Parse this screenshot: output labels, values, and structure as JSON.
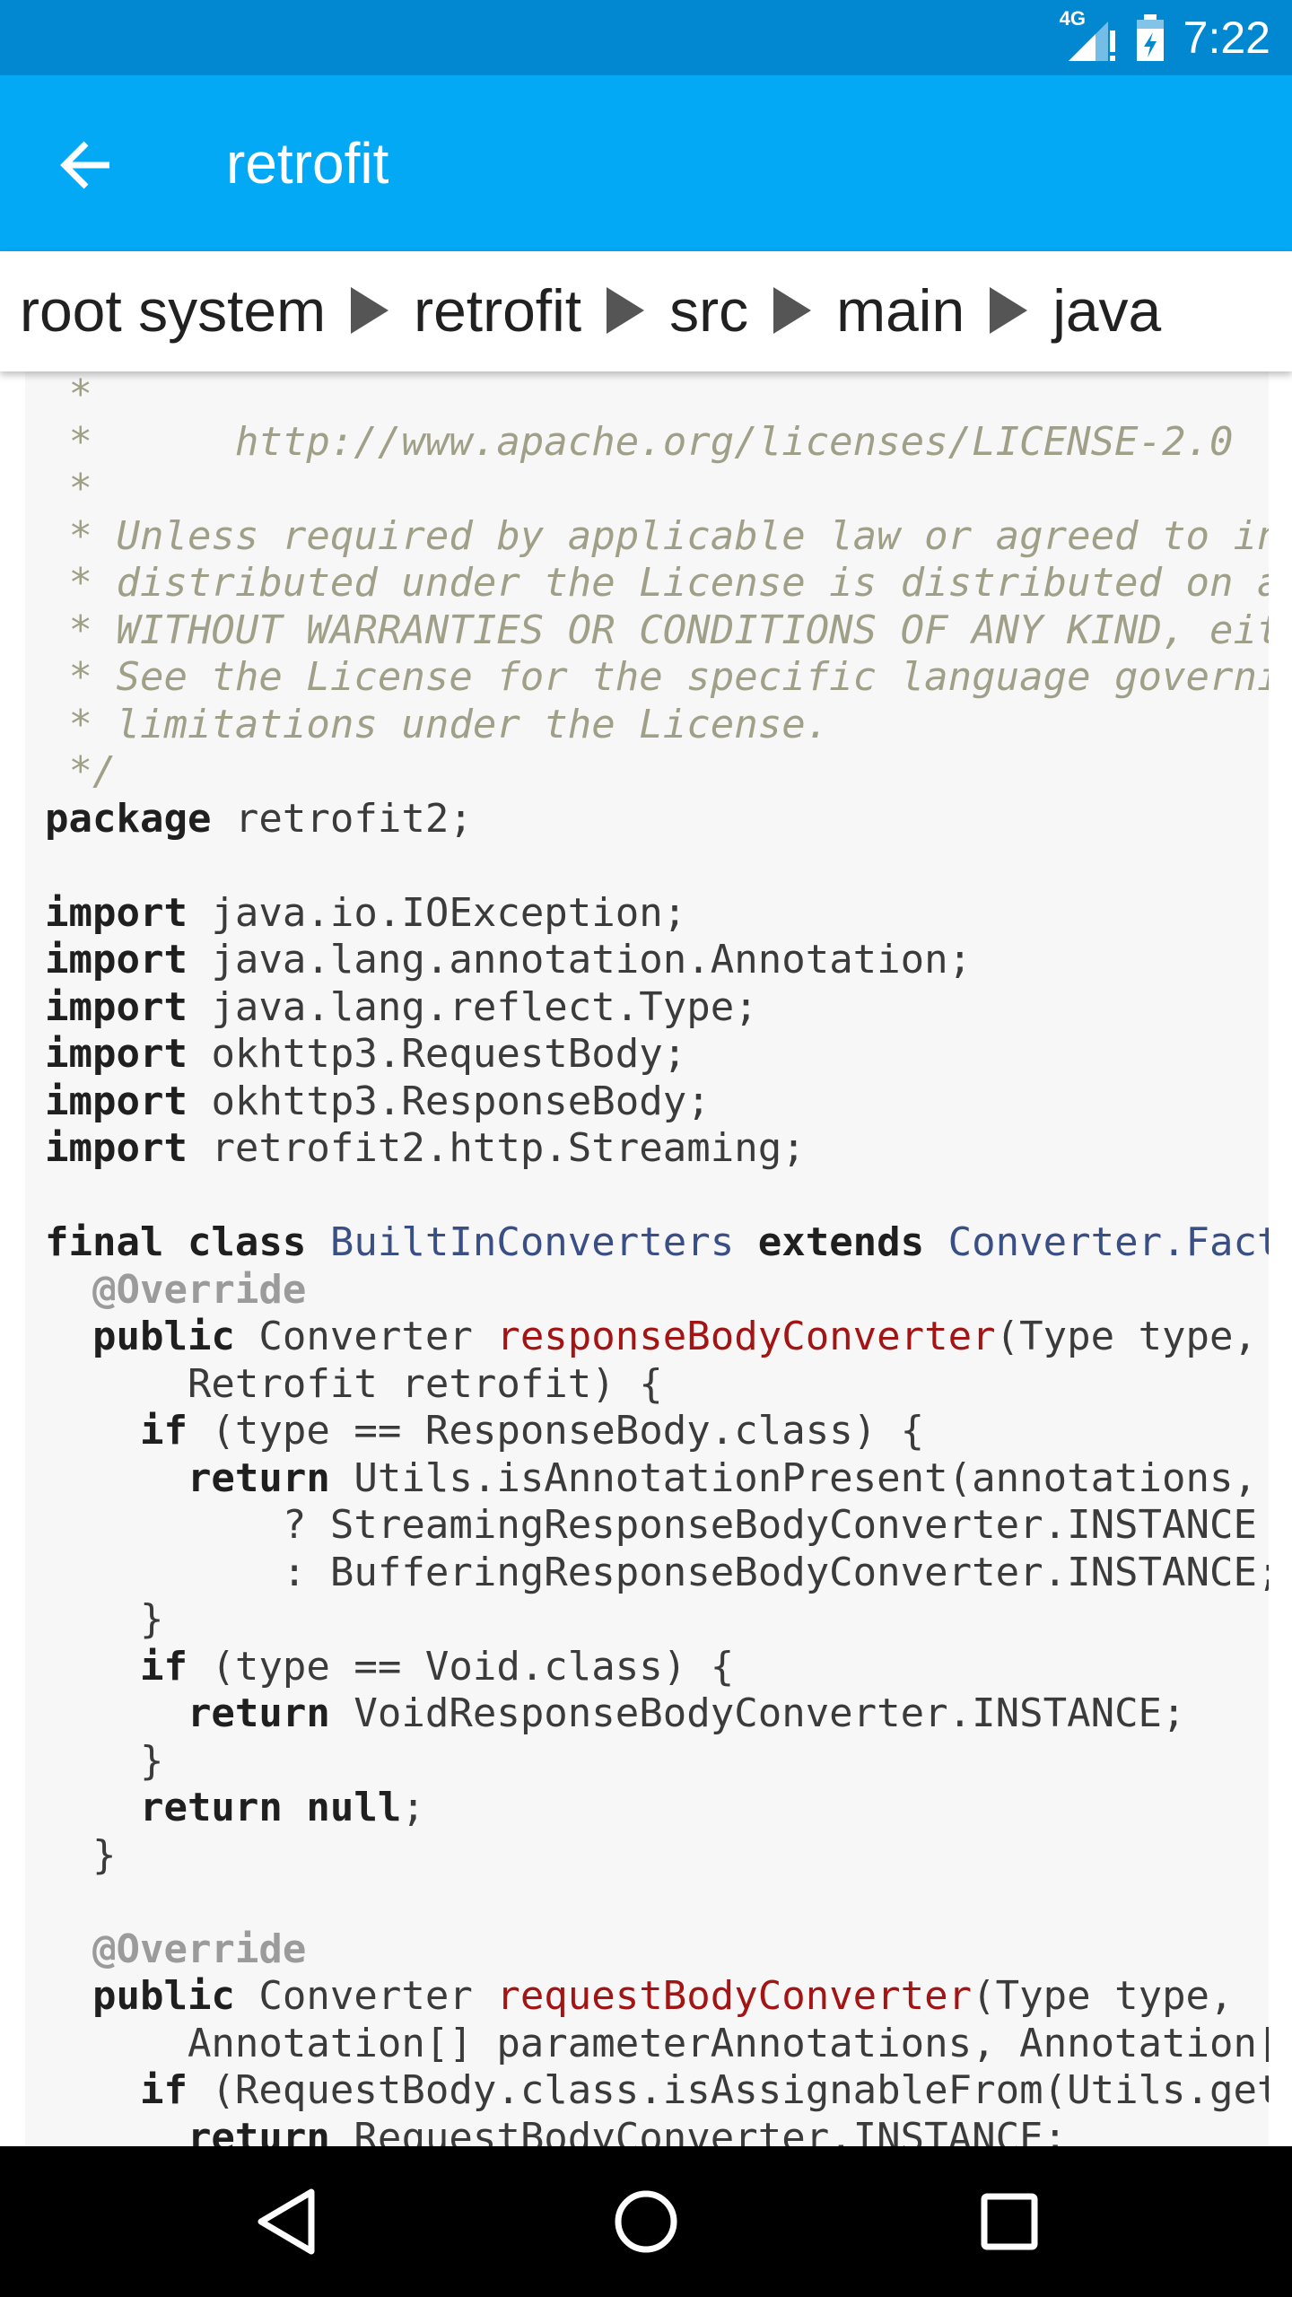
{
  "status_bar": {
    "time": "7:22",
    "network_label": "4G",
    "icons": [
      "signal-icon",
      "battery-icon"
    ]
  },
  "app_bar": {
    "title": "retrofit",
    "back_icon": "arrow-back-icon"
  },
  "breadcrumb": [
    "root system",
    "retrofit",
    "src",
    "main",
    "java"
  ],
  "colors": {
    "status_bar": "#0288d1",
    "app_bar": "#03a9f4",
    "code_background": "#f7f7f7",
    "comment": "#a0a089",
    "keyword": "#1f1f1f",
    "type": "#3a4f86",
    "method": "#a31515",
    "annotation": "#9b9b9b"
  },
  "code_lines": [
    [
      {
        "t": "comment",
        "x": " *"
      }
    ],
    [
      {
        "t": "comment",
        "x": " *      http://www.apache.org/licenses/LICENSE-2.0"
      }
    ],
    [
      {
        "t": "comment",
        "x": " *"
      }
    ],
    [
      {
        "t": "comment",
        "x": " * Unless required by applicable law or agreed to in writing, software"
      }
    ],
    [
      {
        "t": "comment",
        "x": " * distributed under the License is distributed on an \"AS IS\" BASIS,"
      }
    ],
    [
      {
        "t": "comment",
        "x": " * WITHOUT WARRANTIES OR CONDITIONS OF ANY KIND, either express or implied."
      }
    ],
    [
      {
        "t": "comment",
        "x": " * See the License for the specific language governing permissions and"
      }
    ],
    [
      {
        "t": "comment",
        "x": " * limitations under the License."
      }
    ],
    [
      {
        "t": "comment",
        "x": " */"
      }
    ],
    [
      {
        "t": "keyword",
        "x": "package"
      },
      {
        "t": "plain",
        "x": " retrofit2;"
      }
    ],
    [],
    [
      {
        "t": "keyword",
        "x": "import"
      },
      {
        "t": "plain",
        "x": " java.io.IOException;"
      }
    ],
    [
      {
        "t": "keyword",
        "x": "import"
      },
      {
        "t": "plain",
        "x": " java.lang.annotation.Annotation;"
      }
    ],
    [
      {
        "t": "keyword",
        "x": "import"
      },
      {
        "t": "plain",
        "x": " java.lang.reflect.Type;"
      }
    ],
    [
      {
        "t": "keyword",
        "x": "import"
      },
      {
        "t": "plain",
        "x": " okhttp3.RequestBody;"
      }
    ],
    [
      {
        "t": "keyword",
        "x": "import"
      },
      {
        "t": "plain",
        "x": " okhttp3.ResponseBody;"
      }
    ],
    [
      {
        "t": "keyword",
        "x": "import"
      },
      {
        "t": "plain",
        "x": " retrofit2.http.Streaming;"
      }
    ],
    [],
    [
      {
        "t": "keyword",
        "x": "final class "
      },
      {
        "t": "type",
        "x": "BuiltInConverters"
      },
      {
        "t": "keyword",
        "x": " extends "
      },
      {
        "t": "type",
        "x": "Converter.Factory"
      },
      {
        "t": "plain",
        "x": " {"
      }
    ],
    [
      {
        "t": "annotation",
        "x": "  @Override"
      }
    ],
    [
      {
        "t": "keyword",
        "x": "  public"
      },
      {
        "t": "plain",
        "x": " Converter "
      },
      {
        "t": "method",
        "x": "responseBodyConverter"
      },
      {
        "t": "plain",
        "x": "(Type type, Annotation[] annotations,"
      }
    ],
    [
      {
        "t": "plain",
        "x": "      Retrofit retrofit) {"
      }
    ],
    [
      {
        "t": "keyword",
        "x": "    if"
      },
      {
        "t": "plain",
        "x": " (type == ResponseBody.class) {"
      }
    ],
    [
      {
        "t": "keyword",
        "x": "      return"
      },
      {
        "t": "plain",
        "x": " Utils.isAnnotationPresent(annotations, Streaming.class)"
      }
    ],
    [
      {
        "t": "plain",
        "x": "          ? StreamingResponseBodyConverter.INSTANCE"
      }
    ],
    [
      {
        "t": "plain",
        "x": "          : BufferingResponseBodyConverter.INSTANCE;"
      }
    ],
    [
      {
        "t": "plain",
        "x": "    }"
      }
    ],
    [
      {
        "t": "keyword",
        "x": "    if"
      },
      {
        "t": "plain",
        "x": " (type == Void.class) {"
      }
    ],
    [
      {
        "t": "keyword",
        "x": "      return"
      },
      {
        "t": "plain",
        "x": " VoidResponseBodyConverter.INSTANCE;"
      }
    ],
    [
      {
        "t": "plain",
        "x": "    }"
      }
    ],
    [
      {
        "t": "keyword",
        "x": "    return null"
      },
      {
        "t": "plain",
        "x": ";"
      }
    ],
    [
      {
        "t": "plain",
        "x": "  }"
      }
    ],
    [],
    [
      {
        "t": "annotation",
        "x": "  @Override"
      }
    ],
    [
      {
        "t": "keyword",
        "x": "  public"
      },
      {
        "t": "plain",
        "x": " Converter "
      },
      {
        "t": "method",
        "x": "requestBodyConverter"
      },
      {
        "t": "plain",
        "x": "(Type type,"
      }
    ],
    [
      {
        "t": "plain",
        "x": "      Annotation[] parameterAnnotations, Annotation[] methodAnnotations, Retrofit retrofit) {"
      }
    ],
    [
      {
        "t": "keyword",
        "x": "    if"
      },
      {
        "t": "plain",
        "x": " (RequestBody.class.isAssignableFrom(Utils.getRawType(type))) {"
      }
    ],
    [
      {
        "t": "keyword",
        "x": "      return"
      },
      {
        "t": "plain",
        "x": " RequestBodyConverter.INSTANCE;"
      }
    ]
  ],
  "nav_bar": {
    "buttons": [
      "back-triangle-icon",
      "home-circle-icon",
      "recents-square-icon"
    ]
  }
}
